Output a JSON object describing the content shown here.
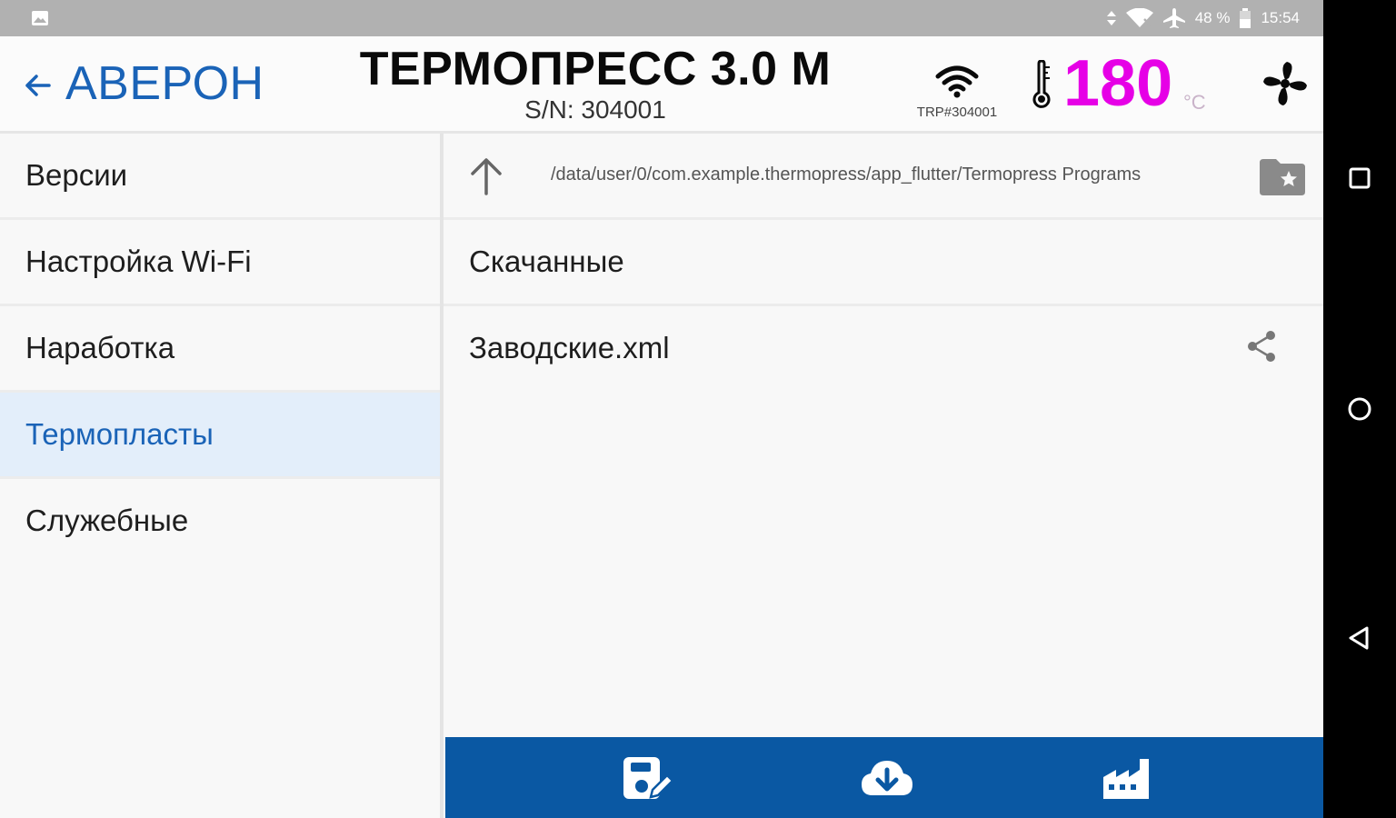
{
  "status_bar": {
    "battery": "48 %",
    "time": "15:54",
    "icons": [
      "image-icon",
      "data-arrows-icon",
      "wifi-x-icon",
      "airplane-icon",
      "battery-icon"
    ]
  },
  "header": {
    "back_label": "АВЕРОН",
    "title": "ТЕРМОПРЕСС 3.0 М",
    "serial": "S/N: 304001",
    "wifi_label": "TRP#304001",
    "temperature": "180",
    "temperature_unit": "°C",
    "temperature_color": "#e600e6"
  },
  "sidebar": {
    "items": [
      {
        "label": "Версии"
      },
      {
        "label": "Настройка Wi-Fi"
      },
      {
        "label": "Наработка"
      },
      {
        "label": "Термопласты"
      },
      {
        "label": "Служебные"
      }
    ],
    "active_index": 3
  },
  "main": {
    "path": "/data/user/0/com.example.thermopress/app_flutter/Termopress Programs",
    "entries": [
      {
        "name": "Скачанные",
        "shareable": false
      },
      {
        "name": "Заводские.xml",
        "shareable": true
      }
    ]
  },
  "bottom_bar": {
    "color": "#0a58a3",
    "buttons": [
      "save-edit-icon",
      "cloud-download-icon",
      "factory-icon"
    ]
  },
  "colors": {
    "accent": "#1a63b7",
    "selected_bg": "#e3eefa"
  }
}
